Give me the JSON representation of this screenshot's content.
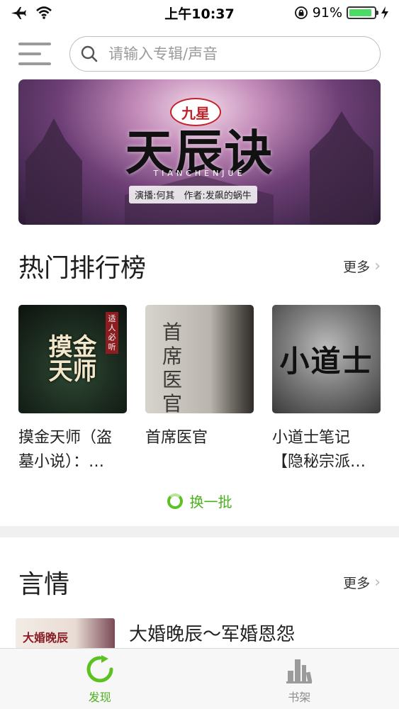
{
  "status_bar": {
    "time": "上午10:37",
    "battery_percent": "91%",
    "battery_level": 0.91
  },
  "search": {
    "placeholder": "请输入专辑/声音"
  },
  "banner": {
    "badge": "九星",
    "title": "天辰诀",
    "subtitle": "TIANCHENJUE",
    "credit": "演播:何其　作者:发飙的蜗牛"
  },
  "hot_section": {
    "title": "热门排行榜",
    "more": "更多",
    "refresh": "换一批",
    "items": [
      {
        "cover_text": "摸金天师",
        "cover_tag": "适人必听",
        "title": "摸金天师（盗墓小说）：…"
      },
      {
        "cover_text": "首席医官",
        "title": "首席医官"
      },
      {
        "cover_text": "小道士",
        "title": "小道士笔记【隐秘宗派…"
      }
    ]
  },
  "romance_section": {
    "title": "言情",
    "more": "更多",
    "items": [
      {
        "cover_text": "大婚晚辰",
        "title": "大婚晚辰～军婚恩怨"
      }
    ]
  },
  "tabbar": {
    "tabs": [
      {
        "label": "发现",
        "icon": "refresh-discover-icon",
        "active": true
      },
      {
        "label": "书架",
        "icon": "bookshelf-icon",
        "active": false
      }
    ]
  },
  "colors": {
    "accent": "#4caf1f",
    "battery": "#4cd964"
  }
}
